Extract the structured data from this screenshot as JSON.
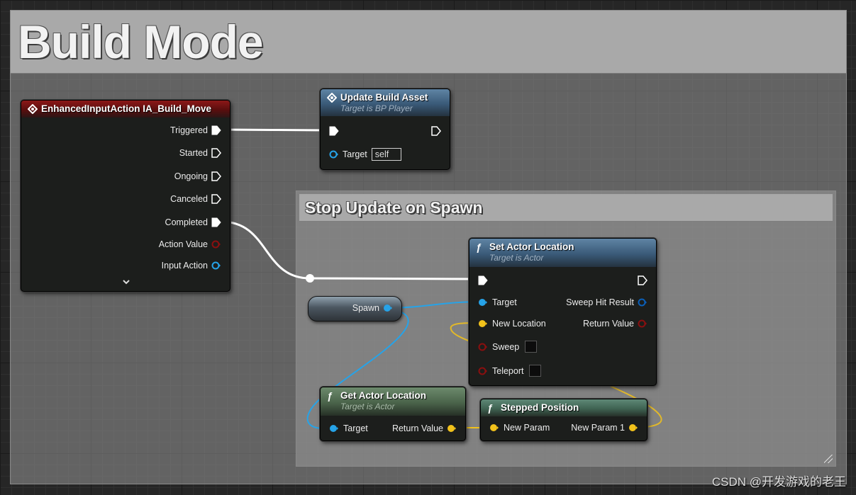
{
  "comments": {
    "build_mode": "Build Mode",
    "stop_update": "Stop Update on Spawn"
  },
  "nodes": {
    "input_action": {
      "title": "EnhancedInputAction IA_Build_Move",
      "icon": "event-diamond-icon",
      "pins": {
        "triggered": "Triggered",
        "started": "Started",
        "ongoing": "Ongoing",
        "canceled": "Canceled",
        "completed": "Completed",
        "action_value": "Action Value",
        "input_action": "Input Action"
      },
      "expand_icon": "chevron-down-icon"
    },
    "update_build_asset": {
      "title": "Update Build Asset",
      "subtitle": "Target is BP Player",
      "pins": {
        "target": "Target",
        "target_default": "self"
      }
    },
    "set_actor_location": {
      "title": "Set Actor Location",
      "subtitle": "Target is Actor",
      "pins": {
        "target": "Target",
        "new_location": "New Location",
        "sweep": "Sweep",
        "teleport": "Teleport",
        "sweep_hit_result": "Sweep Hit Result",
        "return_value": "Return Value"
      }
    },
    "spawn_var": {
      "label": "Spawn"
    },
    "get_actor_location": {
      "title": "Get Actor Location",
      "subtitle": "Target is Actor",
      "pins": {
        "target": "Target",
        "return_value": "Return Value"
      }
    },
    "stepped_position": {
      "title": "Stepped Position",
      "pins": {
        "new_param": "New Param",
        "new_param_1": "New Param 1"
      }
    }
  },
  "colors": {
    "exec": "#ffffff",
    "object": "#26a3e8",
    "vector": "#f2c21b",
    "struct": "#0b5fb8",
    "bool": "#8a0f0f"
  },
  "watermark": "CSDN @开发游戏的老王"
}
